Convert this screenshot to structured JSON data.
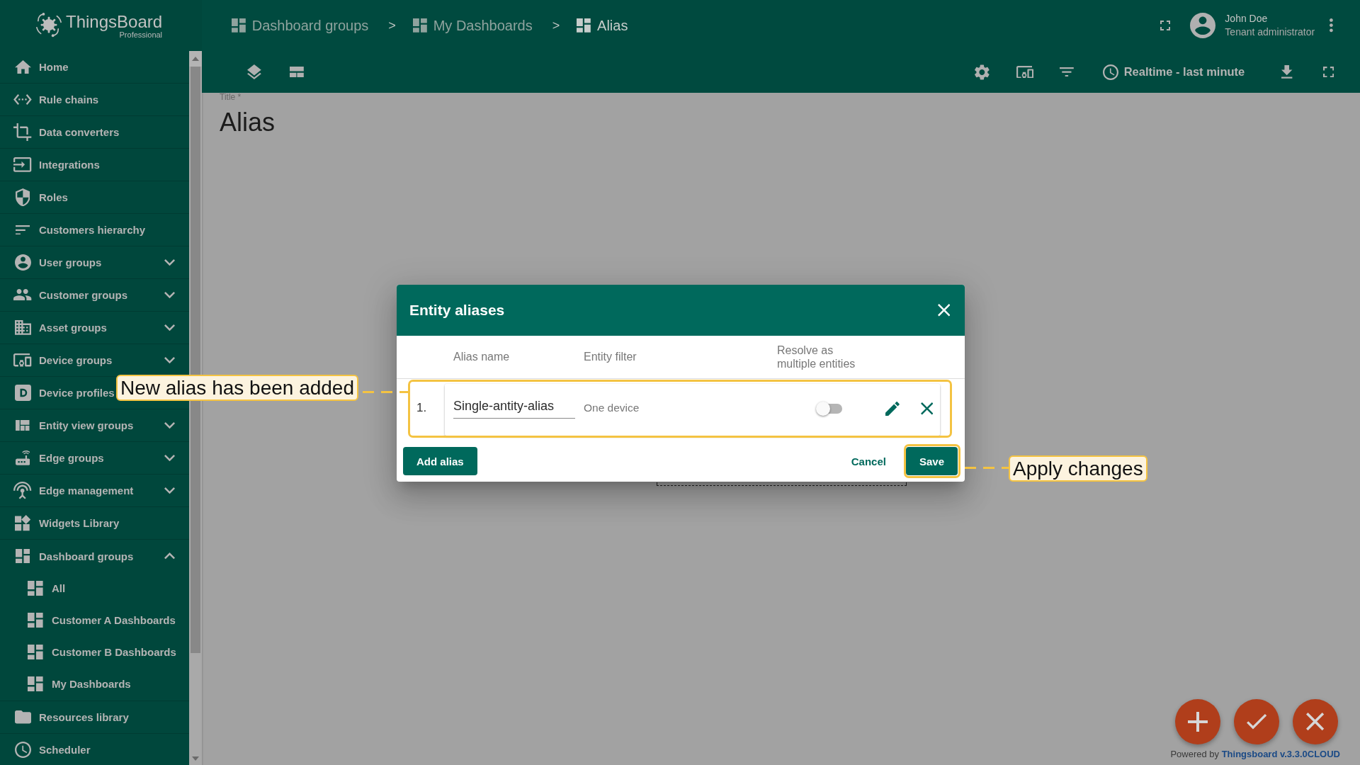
{
  "sidebar": {
    "logo": {
      "title": "ThingsBoard",
      "subtitle": "Professional"
    },
    "items": [
      {
        "label": "Home",
        "kind": "link"
      },
      {
        "label": "Rule chains",
        "kind": "link"
      },
      {
        "label": "Data converters",
        "kind": "link"
      },
      {
        "label": "Integrations",
        "kind": "link"
      },
      {
        "label": "Roles",
        "kind": "link"
      },
      {
        "label": "Customers hierarchy",
        "kind": "link"
      },
      {
        "label": "User groups",
        "kind": "group",
        "expanded": false
      },
      {
        "label": "Customer groups",
        "kind": "group",
        "expanded": false
      },
      {
        "label": "Asset groups",
        "kind": "group",
        "expanded": false
      },
      {
        "label": "Device groups",
        "kind": "group",
        "expanded": false
      },
      {
        "label": "Device profiles",
        "kind": "link"
      },
      {
        "label": "Entity view groups",
        "kind": "group",
        "expanded": false
      },
      {
        "label": "Edge groups",
        "kind": "group",
        "expanded": false
      },
      {
        "label": "Edge management",
        "kind": "group",
        "expanded": false
      },
      {
        "label": "Widgets Library",
        "kind": "link"
      },
      {
        "label": "Dashboard groups",
        "kind": "group",
        "expanded": true,
        "children": [
          {
            "label": "All"
          },
          {
            "label": "Customer A Dashboards"
          },
          {
            "label": "Customer B Dashboards"
          },
          {
            "label": "My Dashboards"
          }
        ]
      },
      {
        "label": "Resources library",
        "kind": "link"
      },
      {
        "label": "Scheduler",
        "kind": "link"
      }
    ]
  },
  "header": {
    "breadcrumbs": [
      {
        "label": "Dashboard groups",
        "selected": false
      },
      {
        "separator": ">",
        "label": "My Dashboards",
        "selected": false
      },
      {
        "separator": ">",
        "label": "Alias",
        "selected": true
      }
    ],
    "user": {
      "name": "John Doe",
      "role": "Tenant administrator"
    }
  },
  "toolbar": {
    "timewindow": "Realtime - last minute"
  },
  "dashboard": {
    "title_label": "Title *",
    "title": "Alias"
  },
  "dialog": {
    "title": "Entity aliases",
    "columns": [
      "Alias name",
      "Entity filter",
      "Resolve as multiple entities"
    ],
    "rows": [
      {
        "number": "1.",
        "alias_name": "Single-antity-alias",
        "entity_filter": "One device",
        "resolve_multiple": false
      }
    ],
    "buttons": {
      "add": "Add alias",
      "cancel": "Cancel",
      "save": "Save"
    }
  },
  "callouts": [
    {
      "text": "New alias has been added"
    },
    {
      "text": "Apply changes"
    }
  ],
  "footer": {
    "prefix": "Powered by",
    "link": "Thingsboard v.3.3.0CLOUD"
  }
}
